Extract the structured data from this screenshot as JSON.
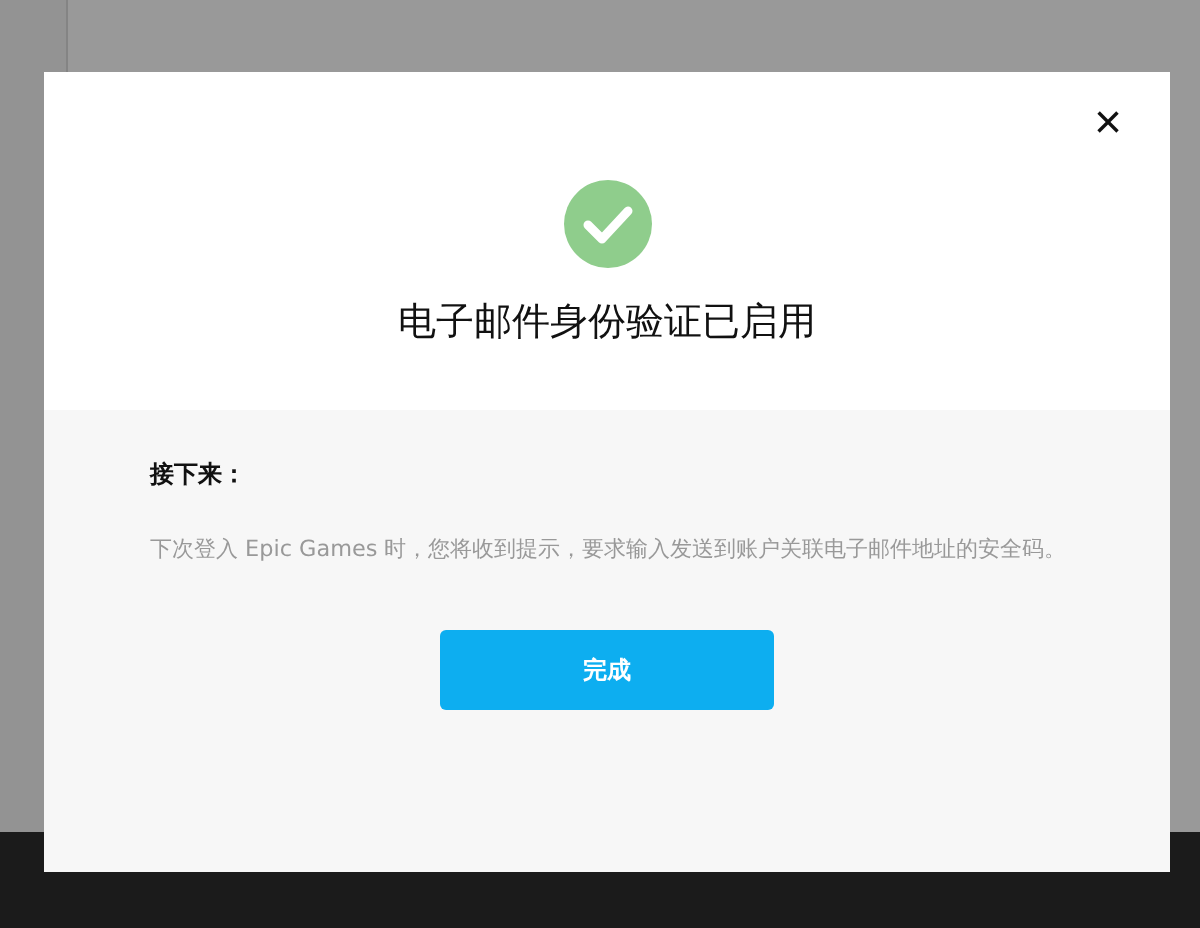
{
  "dialog": {
    "title": "电子邮件身份验证已启用",
    "close_label": "×",
    "section_heading": "接下来：",
    "message": "下次登入 Epic Games 时，您将收到提示，要求输入发送到账户关联电子邮件地址的安全码。",
    "buttons": [
      "完成"
    ]
  }
}
